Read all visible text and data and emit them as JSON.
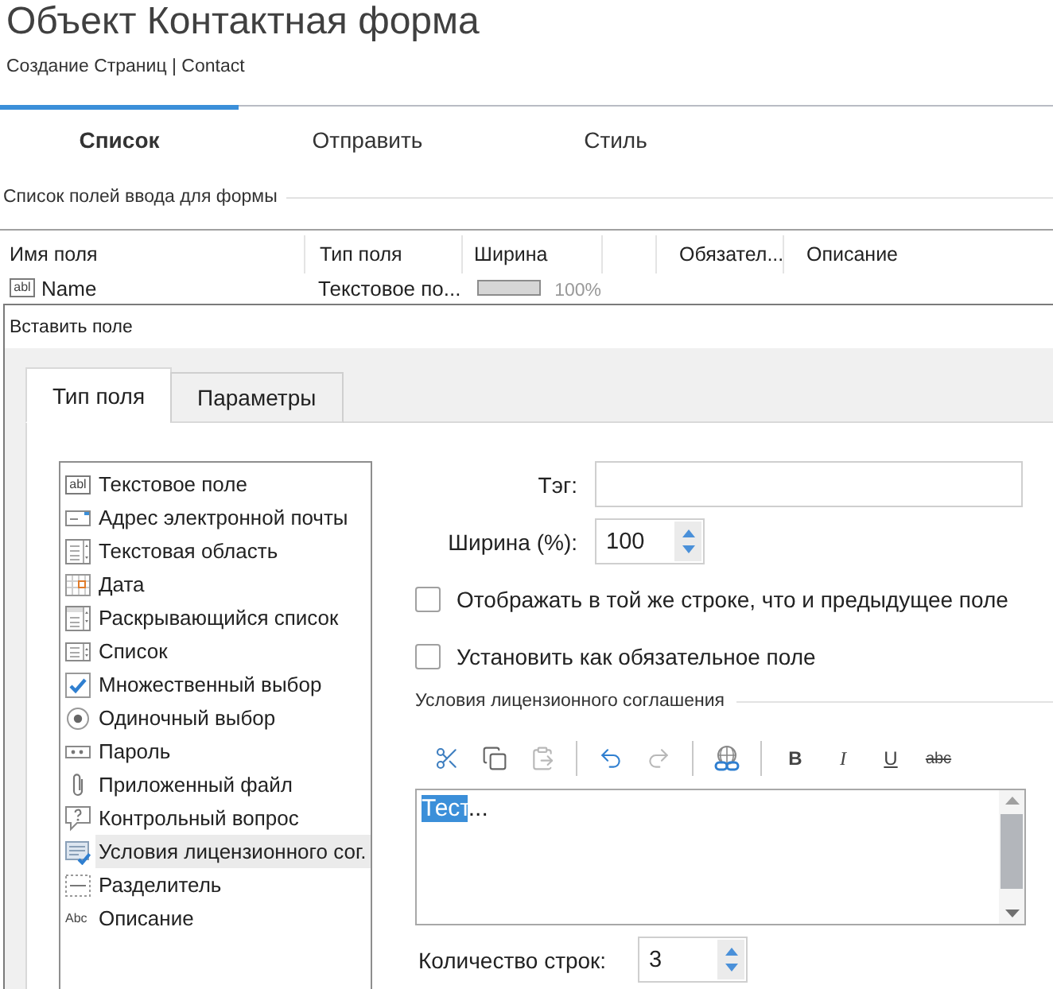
{
  "header": {
    "title": "Объект Контактная форма",
    "breadcrumb": "Создание Страниц | Contact"
  },
  "tabs": [
    {
      "label": "Список",
      "selected": true
    },
    {
      "label": "Отправить",
      "selected": false
    },
    {
      "label": "Стиль",
      "selected": false
    }
  ],
  "fields_section": {
    "title": "Список полей ввода для формы"
  },
  "table": {
    "columns": [
      {
        "label": "Имя поля"
      },
      {
        "label": "Тип поля"
      },
      {
        "label": "Ширина"
      },
      {},
      {
        "label": "Обязател..."
      },
      {
        "label": "Описание"
      }
    ],
    "rows": [
      {
        "kind": "textbox",
        "glyph": "abl",
        "name": "Name",
        "type": "Текстовое по...",
        "width": {
          "level": 1,
          "reading": "100%"
        }
      }
    ]
  },
  "dialog": {
    "title": "Вставить поле",
    "tabs": [
      {
        "label": "Тип поля",
        "selected": true
      },
      {
        "label": "Параметры",
        "selected": false
      }
    ],
    "field_types": [
      {
        "kind": "textbox",
        "glyph": "abl",
        "label": "Текстовое поле",
        "selected": false
      },
      {
        "kind": "email",
        "label": "Адрес электронной почты",
        "selected": false
      },
      {
        "kind": "textarea",
        "label": "Текстовая область",
        "selected": false
      },
      {
        "kind": "date",
        "label": "Дата",
        "selected": false
      },
      {
        "kind": "dropdown",
        "label": "Раскрывающийся список",
        "selected": false
      },
      {
        "kind": "listbox",
        "label": "Список",
        "selected": false
      },
      {
        "kind": "checkbox",
        "label": "Множественный выбор",
        "selected": false
      },
      {
        "kind": "radio",
        "label": "Одиночный выбор",
        "selected": false
      },
      {
        "kind": "password",
        "label": "Пароль",
        "selected": false
      },
      {
        "kind": "file",
        "label": "Приложенный файл",
        "selected": false
      },
      {
        "kind": "captcha",
        "label": "Контрольный вопрос",
        "selected": false
      },
      {
        "kind": "agreement",
        "label": "Условия лицензионного сог.",
        "selected": true
      },
      {
        "kind": "separator",
        "label": "Разделитель",
        "selected": false
      },
      {
        "kind": "description",
        "glyph": "Abc",
        "label": "Описание",
        "selected": false
      }
    ],
    "form": {
      "tag": {
        "label": "Тэг:"
      },
      "width": {
        "label": "Ширина (%):",
        "value": "100"
      },
      "options": [
        {
          "label": "Отображать в той же строке, что и предыдущее поле",
          "checked": false
        },
        {
          "label": "Установить как обязательное поле",
          "checked": false
        }
      ],
      "agreement": {
        "title": "Условия лицензионного соглашения",
        "toolbar": [
          {
            "buttons": [
              {
                "kind": "cut",
                "disabled": false
              },
              {
                "kind": "copy",
                "disabled": false
              },
              {
                "kind": "paste",
                "disabled": true
              }
            ]
          },
          {
            "buttons": [
              {
                "kind": "undo",
                "disabled": false
              },
              {
                "kind": "redo",
                "disabled": true
              }
            ]
          },
          {
            "buttons": [
              {
                "kind": "link",
                "disabled": false
              }
            ]
          },
          {
            "buttons": [
              {
                "kind": "bold",
                "label": "B",
                "disabled": false
              },
              {
                "kind": "italic",
                "label": "I",
                "disabled": false
              },
              {
                "kind": "underline",
                "label": "U",
                "disabled": false
              },
              {
                "kind": "strike",
                "label": "abc",
                "disabled": false
              }
            ]
          }
        ],
        "editor": {
          "content": [
            {
              "text": "Тест",
              "selected": true
            },
            {
              "text": "...",
              "selected": false
            }
          ]
        }
      },
      "line_count": {
        "label": "Количество строк:",
        "value": "3"
      }
    }
  }
}
